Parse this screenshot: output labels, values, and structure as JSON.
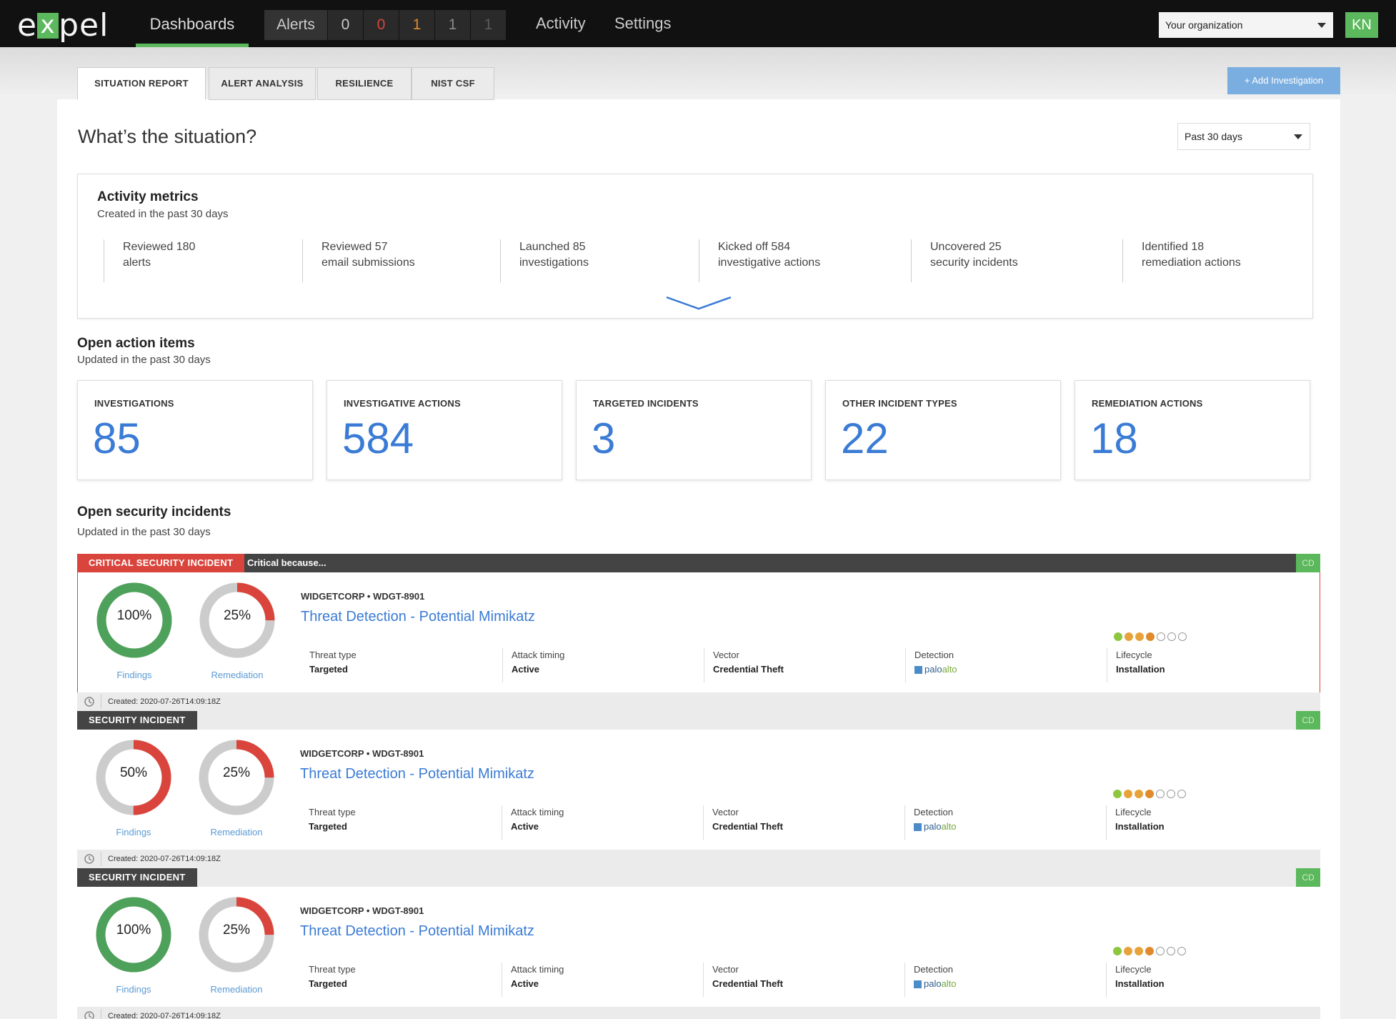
{
  "nav": {
    "logo": "expel",
    "dashboards": "Dashboards",
    "alerts_label": "Alerts",
    "alert_counts": [
      {
        "value": "0",
        "color": "#cccccc"
      },
      {
        "value": "0",
        "color": "#d9453c"
      },
      {
        "value": "1",
        "color": "#e08a2c"
      },
      {
        "value": "1",
        "color": "#8a8a8a"
      },
      {
        "value": "1",
        "color": "#5a5a5a"
      }
    ],
    "activity": "Activity",
    "settings": "Settings",
    "org_select": "Your organization",
    "avatar": "KN"
  },
  "tabs": [
    "SITUATION REPORT",
    "ALERT ANALYSIS",
    "RESILIENCE",
    "NIST CSF"
  ],
  "add_investigation": "+ Add Investigation",
  "page": {
    "title": "What’s the situation?",
    "range": "Past 30 days"
  },
  "activity_metrics": {
    "heading": "Activity metrics",
    "sub": "Created in the past 30 days",
    "items": [
      {
        "line1": "Reviewed 180",
        "line2": "alerts"
      },
      {
        "line1": "Reviewed 57",
        "line2": "email submissions"
      },
      {
        "line1": "Launched 85",
        "line2": "investigations"
      },
      {
        "line1": "Kicked off 584",
        "line2": "investigative actions"
      },
      {
        "line1": "Uncovered 25",
        "line2": "security incidents"
      },
      {
        "line1": "Identified 18",
        "line2": "remediation actions"
      }
    ]
  },
  "open_action_items": {
    "heading": "Open action items",
    "sub": "Updated in the past 30 days",
    "stats": [
      {
        "label": "INVESTIGATIONS",
        "value": "85"
      },
      {
        "label": "INVESTIGATIVE ACTIONS",
        "value": "584"
      },
      {
        "label": "TARGETED INCIDENTS",
        "value": "3"
      },
      {
        "label": "OTHER INCIDENT TYPES",
        "value": "22"
      },
      {
        "label": "REMEDIATION ACTIONS",
        "value": "18"
      }
    ]
  },
  "open_incidents": {
    "heading": "Open security incidents",
    "sub": "Updated in the past 30 days",
    "incidents": [
      {
        "type": "CRITICAL SECURITY INCIDENT",
        "reason": "Critical because...",
        "cd": "CD",
        "findings_pct": 100,
        "findings_label": "100%",
        "remediation_pct": 25,
        "remediation_label": "25%",
        "findings_caption": "Findings",
        "remediation_caption": "Remediation",
        "org": "WIDGETCORP  •  WDGT-8901",
        "title": "Threat Detection - Potential Mimikatz",
        "threat_type_k": "Threat type",
        "threat_type": "Targeted",
        "attack_timing_k": "Attack timing",
        "attack_timing": "Active",
        "vector_k": "Vector",
        "vector": "Credential Theft",
        "detection_k": "Detection",
        "detection_a": "palo",
        "detection_b": "alto",
        "lifecycle_k": "Lifecycle",
        "lifecycle": "Installation",
        "lifecycle_stage": 4,
        "created_k": "Created:",
        "created": "2020-07-26T14:09:18Z"
      },
      {
        "type": "SECURITY INCIDENT",
        "reason": "",
        "cd": "CD",
        "findings_pct": 50,
        "findings_label": "50%",
        "remediation_pct": 25,
        "remediation_label": "25%",
        "findings_caption": "Findings",
        "remediation_caption": "Remediation",
        "org": "WIDGETCORP  •  WDGT-8901",
        "title": "Threat Detection - Potential Mimikatz",
        "threat_type_k": "Threat type",
        "threat_type": "Targeted",
        "attack_timing_k": "Attack timing",
        "attack_timing": "Active",
        "vector_k": "Vector",
        "vector": "Credential Theft",
        "detection_k": "Detection",
        "detection_a": "palo",
        "detection_b": "alto",
        "lifecycle_k": "Lifecycle",
        "lifecycle": "Installation",
        "lifecycle_stage": 4,
        "created_k": "Created:",
        "created": "2020-07-26T14:09:18Z"
      },
      {
        "type": "SECURITY INCIDENT",
        "reason": "",
        "cd": "CD",
        "findings_pct": 100,
        "findings_label": "100%",
        "remediation_pct": 25,
        "remediation_label": "25%",
        "findings_caption": "Findings",
        "remediation_caption": "Remediation",
        "org": "WIDGETCORP  •  WDGT-8901",
        "title": "Threat Detection - Potential Mimikatz",
        "threat_type_k": "Threat type",
        "threat_type": "Targeted",
        "attack_timing_k": "Attack timing",
        "attack_timing": "Active",
        "vector_k": "Vector",
        "vector": "Credential Theft",
        "detection_k": "Detection",
        "detection_a": "palo",
        "detection_b": "alto",
        "lifecycle_k": "Lifecycle",
        "lifecycle": "Installation",
        "lifecycle_stage": 4,
        "created_k": "Created:",
        "created": "2020-07-26T14:09:18Z"
      }
    ]
  },
  "colors": {
    "accent_green": "#5cb85c",
    "link_blue": "#3a7bd5",
    "critical_red": "#d9453c",
    "ring_gray": "#cccccc",
    "lifecycle_dots": [
      "#8dc63f",
      "#e8a23a",
      "#e8a23a",
      "#e08a2c"
    ]
  },
  "icons": {
    "expand": "chevron-down-icon",
    "history": "history-icon",
    "detection": "paloalto-logo"
  }
}
